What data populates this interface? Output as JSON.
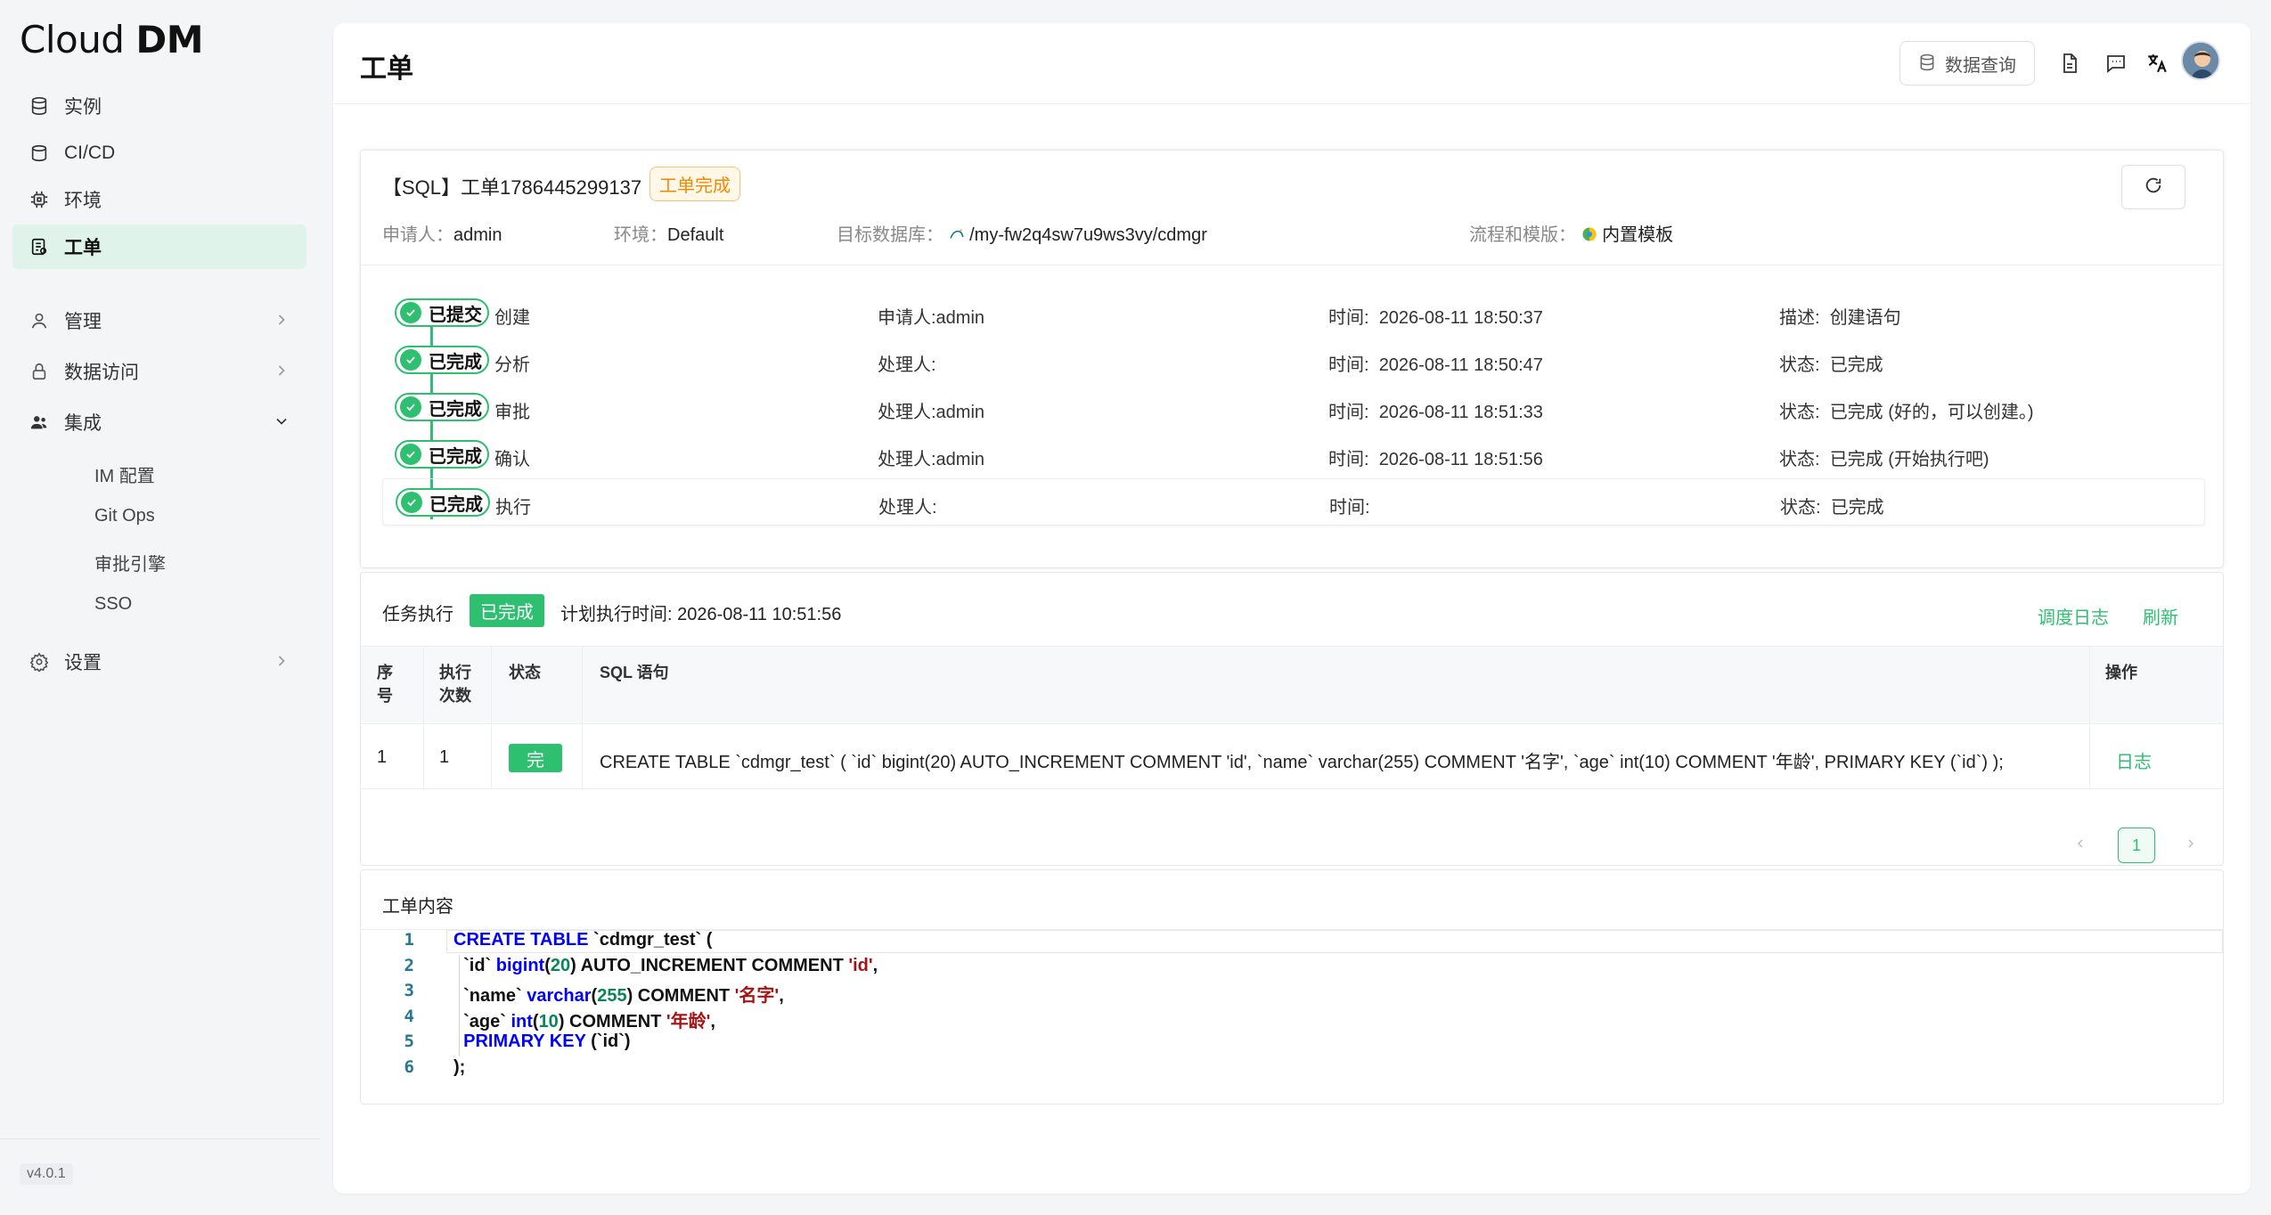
{
  "app": {
    "logo_text_light": "Cloud",
    "logo_text_bold": "DM",
    "version": "v4.0.1"
  },
  "sidebar": {
    "items": [
      {
        "label": "实例",
        "icon": "database-icon"
      },
      {
        "label": "CI/CD",
        "icon": "stack-icon"
      },
      {
        "label": "环境",
        "icon": "chip-icon"
      },
      {
        "label": "工单",
        "icon": "ticket-icon",
        "active": true
      },
      {
        "label": "管理",
        "icon": "user-icon"
      },
      {
        "label": "数据访问",
        "icon": "lock-icon"
      },
      {
        "label": "集成",
        "icon": "group-icon"
      },
      {
        "label": "设置",
        "icon": "gear-icon"
      }
    ],
    "sub_items": [
      "IM 配置",
      "Git Ops",
      "审批引擎",
      "SSO"
    ]
  },
  "header": {
    "title": "工单",
    "data_query_label": "数据查询"
  },
  "ticket": {
    "title": "【SQL】工单1786445299137",
    "status_tag": "工单完成",
    "applicant_label": "申请人：",
    "applicant": "admin",
    "env_label": "环境：",
    "env": "Default",
    "target_label": "目标数据库：",
    "target": "/my-fw2q4sw7u9ws3vy/cdmgr",
    "flow_label": "流程和模版：",
    "flow": "内置模板"
  },
  "steps": [
    {
      "badge": "已提交",
      "name": "创建",
      "person": "申请人:admin",
      "time_label": "时间:",
      "time": "2026-08-11 18:50:37",
      "info_label": "描述:",
      "info": "创建语句"
    },
    {
      "badge": "已完成",
      "name": "分析",
      "person": "处理人:",
      "time_label": "时间:",
      "time": "2026-08-11 18:50:47",
      "info_label": "状态:",
      "info": "已完成"
    },
    {
      "badge": "已完成",
      "name": "审批",
      "person": "处理人:admin",
      "time_label": "时间:",
      "time": "2026-08-11 18:51:33",
      "info_label": "状态:",
      "info": "已完成 (好的，可以创建。)"
    },
    {
      "badge": "已完成",
      "name": "确认",
      "person": "处理人:admin",
      "time_label": "时间:",
      "time": "2026-08-11 18:51:56",
      "info_label": "状态:",
      "info": "已完成 (开始执行吧)"
    },
    {
      "badge": "已完成",
      "name": "执行",
      "person": "处理人:",
      "time_label": "时间:",
      "time": "",
      "info_label": "状态:",
      "info": "已完成"
    }
  ],
  "task": {
    "title": "任务执行",
    "status": "已完成",
    "plan_time": "计划执行时间: 2026-08-11 10:51:56",
    "log_link": "调度日志",
    "refresh_link": "刷新",
    "columns": {
      "seq_1": "序",
      "seq_2": "号",
      "runs_1": "执行",
      "runs_2": "次数",
      "status": "状态",
      "sql": "SQL 语句",
      "ops": "操作"
    },
    "rows": [
      {
        "seq": "1",
        "runs": "1",
        "status": "完",
        "sql": "CREATE TABLE `cdmgr_test` ( `id` bigint(20) AUTO_INCREMENT COMMENT 'id', `name` varchar(255) COMMENT '名字', `age` int(10) COMMENT '年龄', PRIMARY KEY (`id`) );",
        "op": "日志"
      }
    ],
    "page": "1"
  },
  "content": {
    "title": "工单内容",
    "line_numbers": [
      "1",
      "2",
      "3",
      "4",
      "5",
      "6"
    ],
    "sql_lines": [
      "CREATE TABLE `cdmgr_test` (",
      "  `id` bigint(20) AUTO_INCREMENT COMMENT 'id',",
      "  `name` varchar(255) COMMENT '名字',",
      "  `age` int(10) COMMENT '年龄',",
      "  PRIMARY KEY (`id`)",
      ");"
    ]
  },
  "colors": {
    "accent": "#2fbf71",
    "active_bg": "#dff3eb",
    "warn": "#f08a00"
  }
}
